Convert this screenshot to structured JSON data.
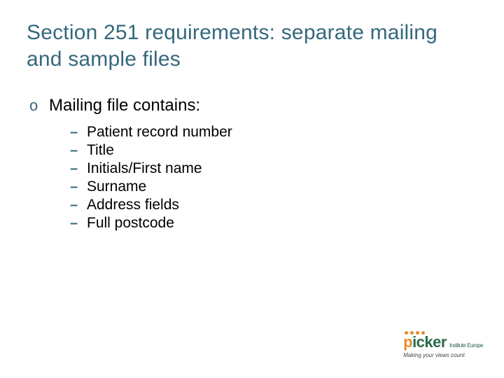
{
  "title": "Section 251 requirements: separate mailing and sample files",
  "level1": {
    "bullet": "o",
    "text": "Mailing file contains:"
  },
  "items": [
    "Patient record number",
    "Title",
    "Initials/First name",
    "Surname",
    "Address fields",
    "Full postcode"
  ],
  "sub_bullet": "–",
  "logo": {
    "p": "p",
    "rest": "icker",
    "institute": "Institute Europe",
    "tagline": "Making your views count"
  }
}
